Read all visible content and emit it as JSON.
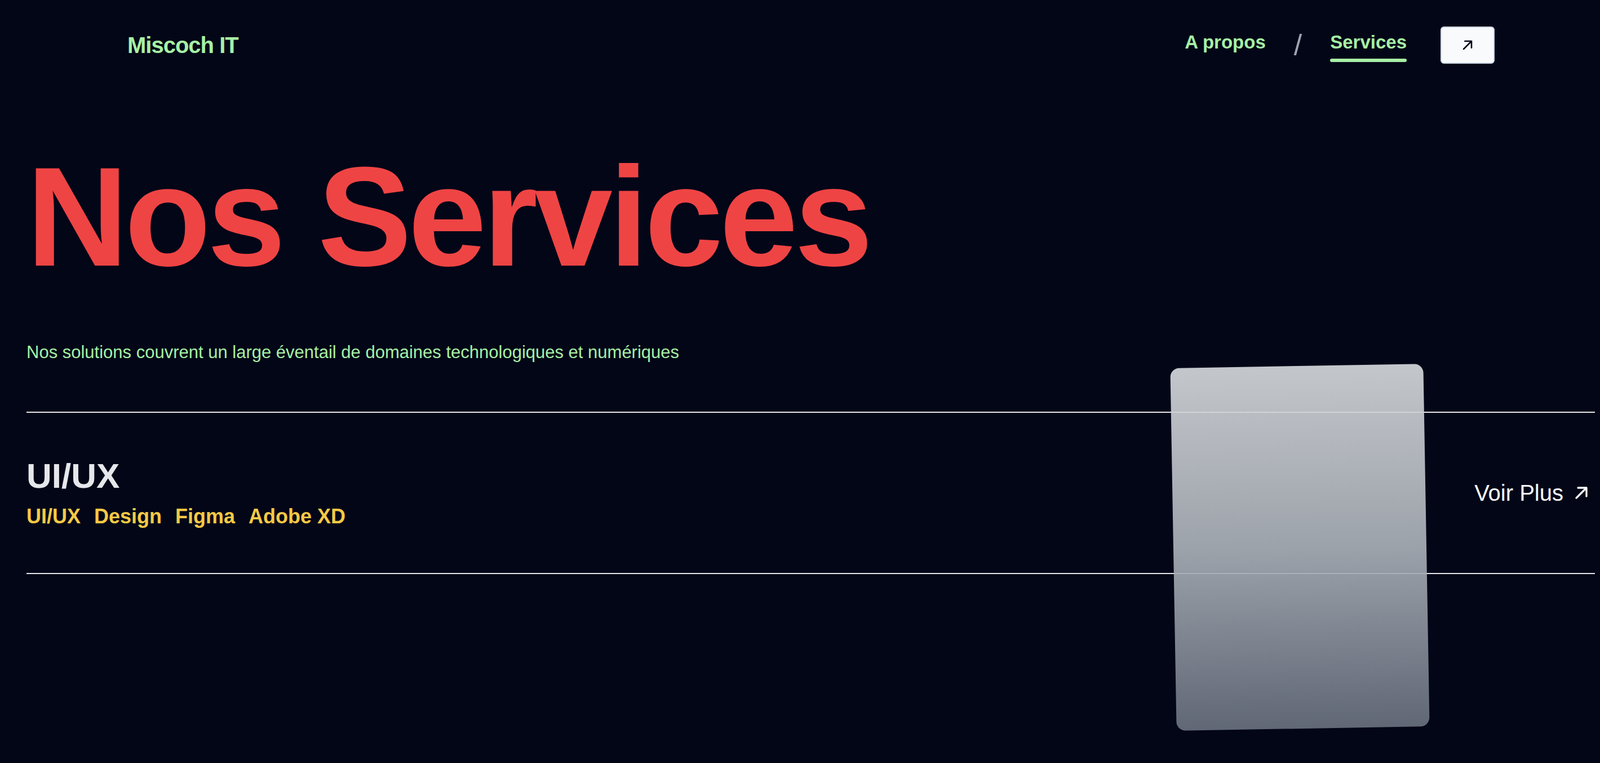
{
  "logo": "Miscoch IT",
  "nav": {
    "items": [
      {
        "label": "A propos",
        "selected": false
      },
      {
        "label": "Services",
        "selected": true
      }
    ],
    "separator": "/"
  },
  "hero": {
    "title": "Nos Services",
    "subtitle": "Nos solutions couvrent un large éventail de domaines technologiques et numériques"
  },
  "services": [
    {
      "title": "UI/UX",
      "tags": [
        "UI/UX",
        "Design",
        "Figma",
        "Adobe XD"
      ],
      "link": "Voir Plus"
    }
  ]
}
